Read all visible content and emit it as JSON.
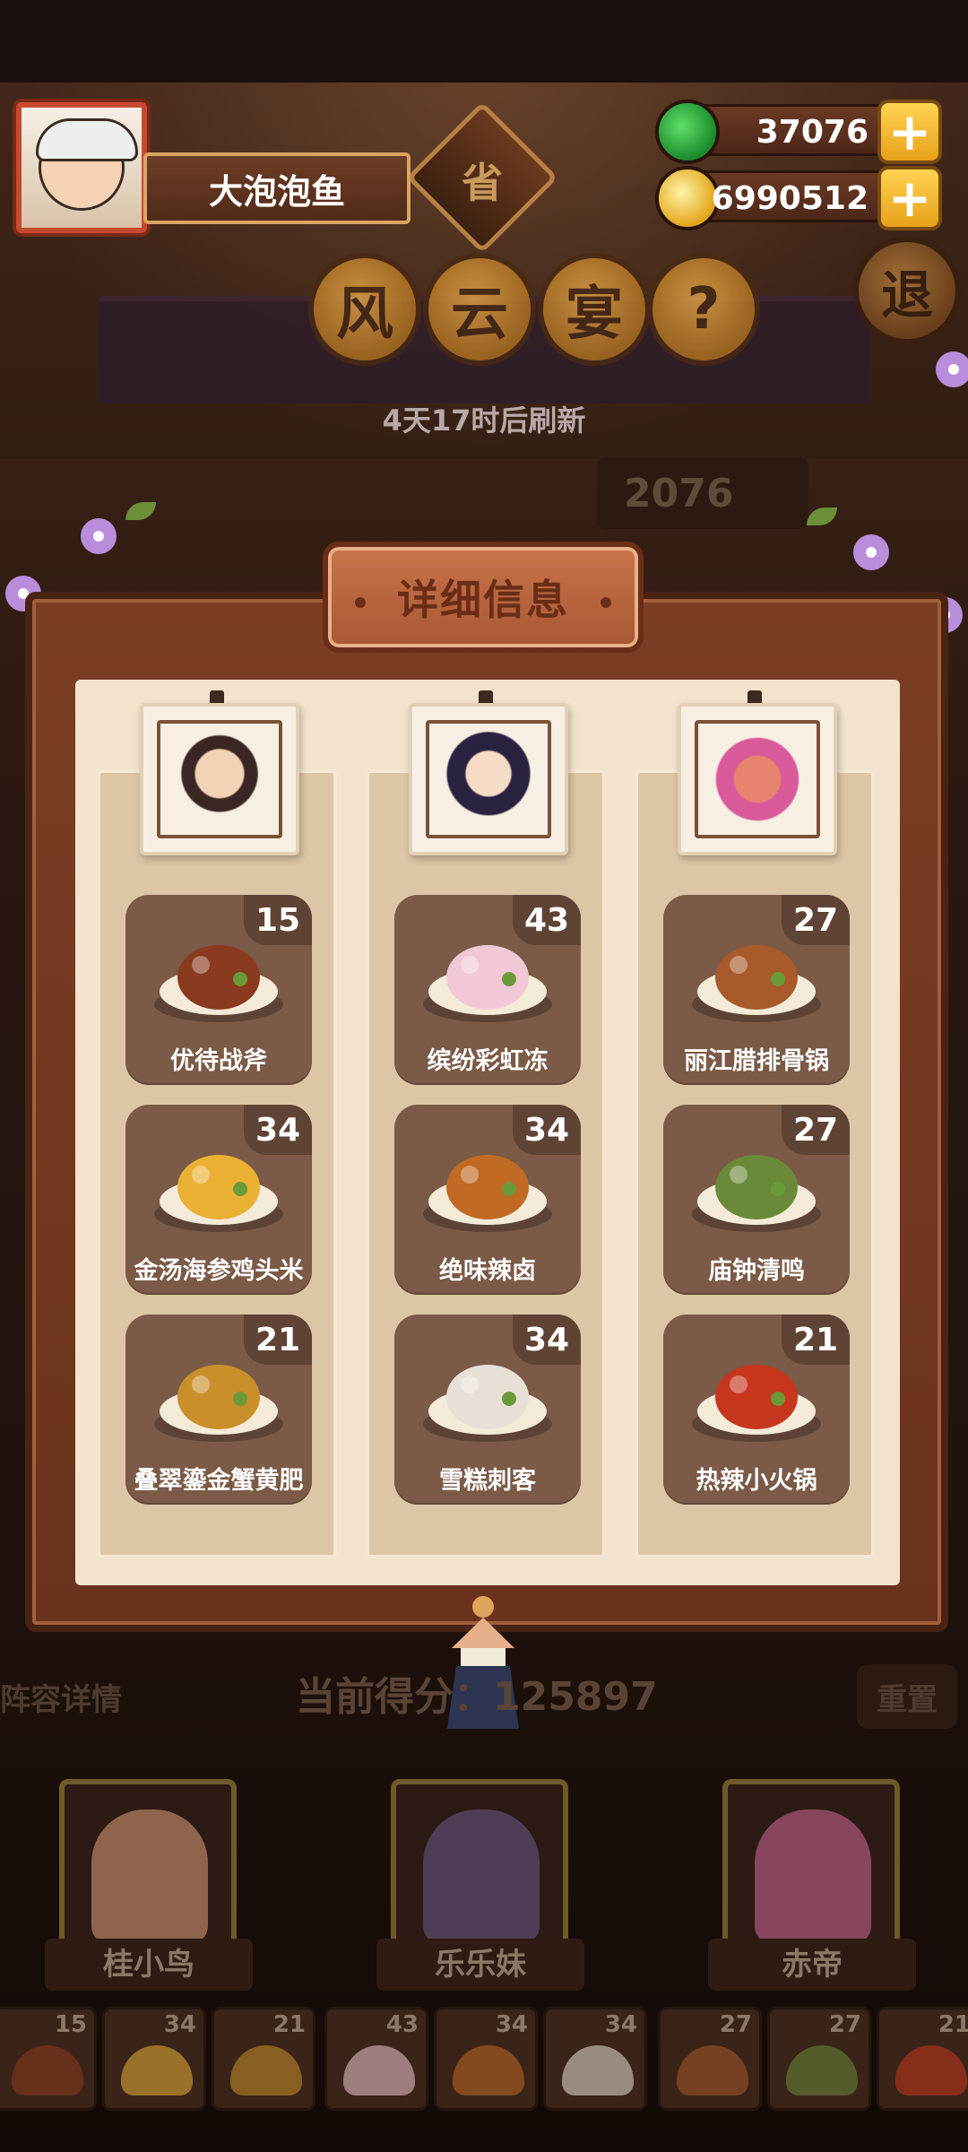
{
  "player": {
    "name": "大泡泡鱼"
  },
  "province_badge": "省",
  "currencies": {
    "jade": "37076",
    "gold": "6990512"
  },
  "event_title": [
    "风",
    "云",
    "宴",
    "?"
  ],
  "exit_label": "退",
  "refresh_text": "4天17时后刷新",
  "bg_score": "2076",
  "dialog": {
    "title": "详细信息",
    "columns": [
      {
        "character": "桂小鸟",
        "dishes": [
          {
            "name": "优待战斧",
            "count": "15",
            "icon": "steak-icon",
            "color": "#8a3a1e"
          },
          {
            "name": "金汤海参鸡头米",
            "count": "34",
            "icon": "golden-soup-icon",
            "color": "#e9b034"
          },
          {
            "name": "叠翠鎏金蟹黄肥",
            "count": "21",
            "icon": "crab-tower-icon",
            "color": "#c98f2a"
          }
        ]
      },
      {
        "character": "乐乐妹",
        "dishes": [
          {
            "name": "缤纷彩虹冻",
            "count": "43",
            "icon": "jelly-icon",
            "color": "#f3c8d6"
          },
          {
            "name": "绝味辣卤",
            "count": "34",
            "icon": "braised-chicken-icon",
            "color": "#c06a24"
          },
          {
            "name": "雪糕刺客",
            "count": "34",
            "icon": "ice-cream-icon",
            "color": "#e8e0d6"
          }
        ]
      },
      {
        "character": "赤帝",
        "dishes": [
          {
            "name": "丽江腊排骨锅",
            "count": "27",
            "icon": "rib-pot-icon",
            "color": "#a85a2a"
          },
          {
            "name": "庙钟清鸣",
            "count": "27",
            "icon": "bonsai-platter-icon",
            "color": "#6a8a3a"
          },
          {
            "name": "热辣小火锅",
            "count": "21",
            "icon": "hotpot-icon",
            "color": "#c7361e"
          }
        ]
      }
    ]
  },
  "bottom": {
    "lineup_label": "阵容详情",
    "score_text": "当前得分：125897",
    "reset_label": "重置",
    "heroes": [
      {
        "name": "桂小鸟",
        "color": "#e4a07a"
      },
      {
        "name": "乐乐妹",
        "color": "#6b5a8a"
      },
      {
        "name": "赤帝",
        "color": "#d46a9a"
      }
    ],
    "slots": [
      "15",
      "34",
      "21",
      "43",
      "34",
      "34",
      "27",
      "27",
      "21"
    ]
  },
  "colors": {
    "accent": "#c9744a",
    "plus": "#ffd352",
    "jade": "#1a8b2c",
    "gold": "#e2a61a"
  }
}
